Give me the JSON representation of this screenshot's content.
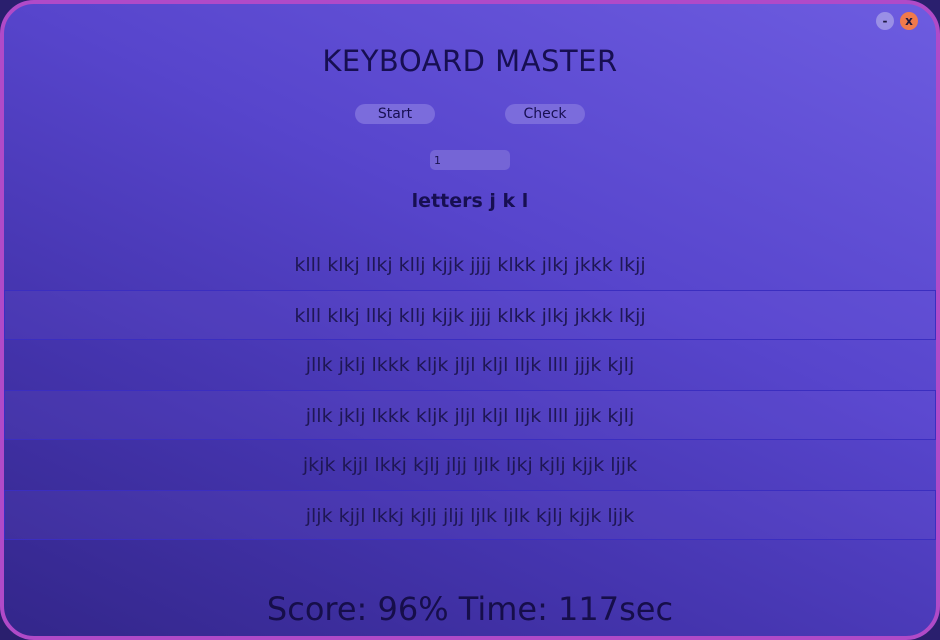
{
  "window": {
    "minimize_label": "-",
    "close_label": "x"
  },
  "header": {
    "title": "KEYBOARD MASTER"
  },
  "buttons": {
    "start_label": "Start",
    "check_label": "Check"
  },
  "level_input": {
    "value": "1"
  },
  "subtitle": "letters j k l",
  "exercise": {
    "pairs": [
      {
        "target": "klll klkj llkj kllj kjjk jjjj klkk jlkj jkkk lkjj",
        "typed": "klll klkj llkj kllj kjjk jjjj klkk jlkj jkkk lkjj"
      },
      {
        "target": "jllk jklj lkkk kljk jljl kljl lljk llll jjjk kjlj",
        "typed": "jllk jklj lkkk kljk jljl kljl lljk llll jjjk kjlj"
      },
      {
        "target": "jkjk kjjl lkkj kjlj jljj ljlk ljkj kjlj kjjk ljjk",
        "typed": "jljk kjjl lkkj kjlj jljj ljlk ljlk kjlj kjjk ljjk"
      }
    ]
  },
  "footer": {
    "score_text": "Score: 96% Time: 117sec"
  },
  "colors": {
    "border": "#b04ac8",
    "close_button": "#f07a4c",
    "minimize_button": "#9a8fe6",
    "text": "#170f52"
  }
}
